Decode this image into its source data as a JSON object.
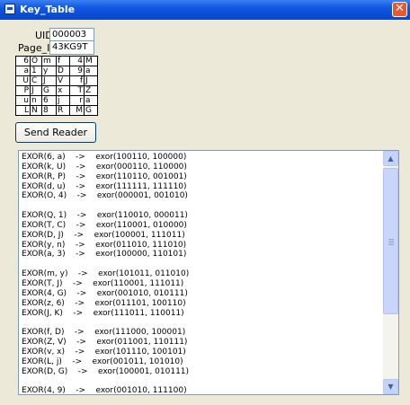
{
  "window": {
    "title": "Key_Table",
    "icon": "app-window-icon",
    "close_icon": "close-icon",
    "close_glyph": "✕"
  },
  "form": {
    "uid_label": "UID",
    "uid_value": "000003",
    "page_id_label": "Page_ID",
    "page_id_value": "43KG9T"
  },
  "key_table": {
    "rows": [
      [
        "6",
        "O",
        "m",
        "f",
        "4",
        "M"
      ],
      [
        "a",
        "1",
        "y",
        "D",
        "9",
        "a"
      ],
      [
        "U",
        "C",
        "J",
        "V",
        "f",
        "J"
      ],
      [
        "P",
        "J",
        "G",
        "x",
        "T",
        "Z"
      ],
      [
        "u",
        "n",
        "6",
        "j",
        "r",
        "a"
      ],
      [
        "L",
        "N",
        "8",
        "R",
        "M",
        "G"
      ]
    ]
  },
  "send_button_label": "Send Reader",
  "log": {
    "lines": [
      "EXOR(6, a)    ->    exor(100110, 100000)",
      "EXOR(k, U)    ->    exor(000110, 110000)",
      "EXOR(R, P)    ->    exor(110110, 001001)",
      "EXOR(d, u)    ->    exor(111111, 111110)",
      "EXOR(O, 4)    ->    exor(000001, 001010)",
      "",
      "EXOR(Q, 1)    ->    exor(110010, 000011)",
      "EXOR(T, C)    ->    exor(110001, 010000)",
      "EXOR(D, J)    ->    exor(100001, 111011)",
      "EXOR(y, n)    ->    exor(011010, 111010)",
      "EXOR(a, 3)    ->    exor(100000, 110101)",
      "",
      "EXOR(m, y)    ->    exor(101011, 011010)",
      "EXOR(T, J)    ->    exor(110001, 111011)",
      "EXOR(4, G)    ->    exor(001010, 010111)",
      "EXOR(z, 6)    ->    exor(011101, 100110)",
      "EXOR(J, K)    ->    exor(111011, 110011)",
      "",
      "EXOR(f, D)    ->    exor(111000, 100001)",
      "EXOR(Z, V)    ->    exor(011001, 110111)",
      "EXOR(v, x)    ->    exor(101110, 100101)",
      "EXOR(L, j)    ->    exor(001011, 101010)",
      "EXOR(D, G)    ->    exor(100001, 010111)",
      "",
      "EXOR(4, 9)    ->    exor(001010, 111100)"
    ]
  },
  "scrollbar": {
    "up_icon": "scroll-up-arrow-icon",
    "down_icon": "scroll-down-arrow-icon",
    "up_glyph": "▲",
    "down_glyph": "▼"
  }
}
